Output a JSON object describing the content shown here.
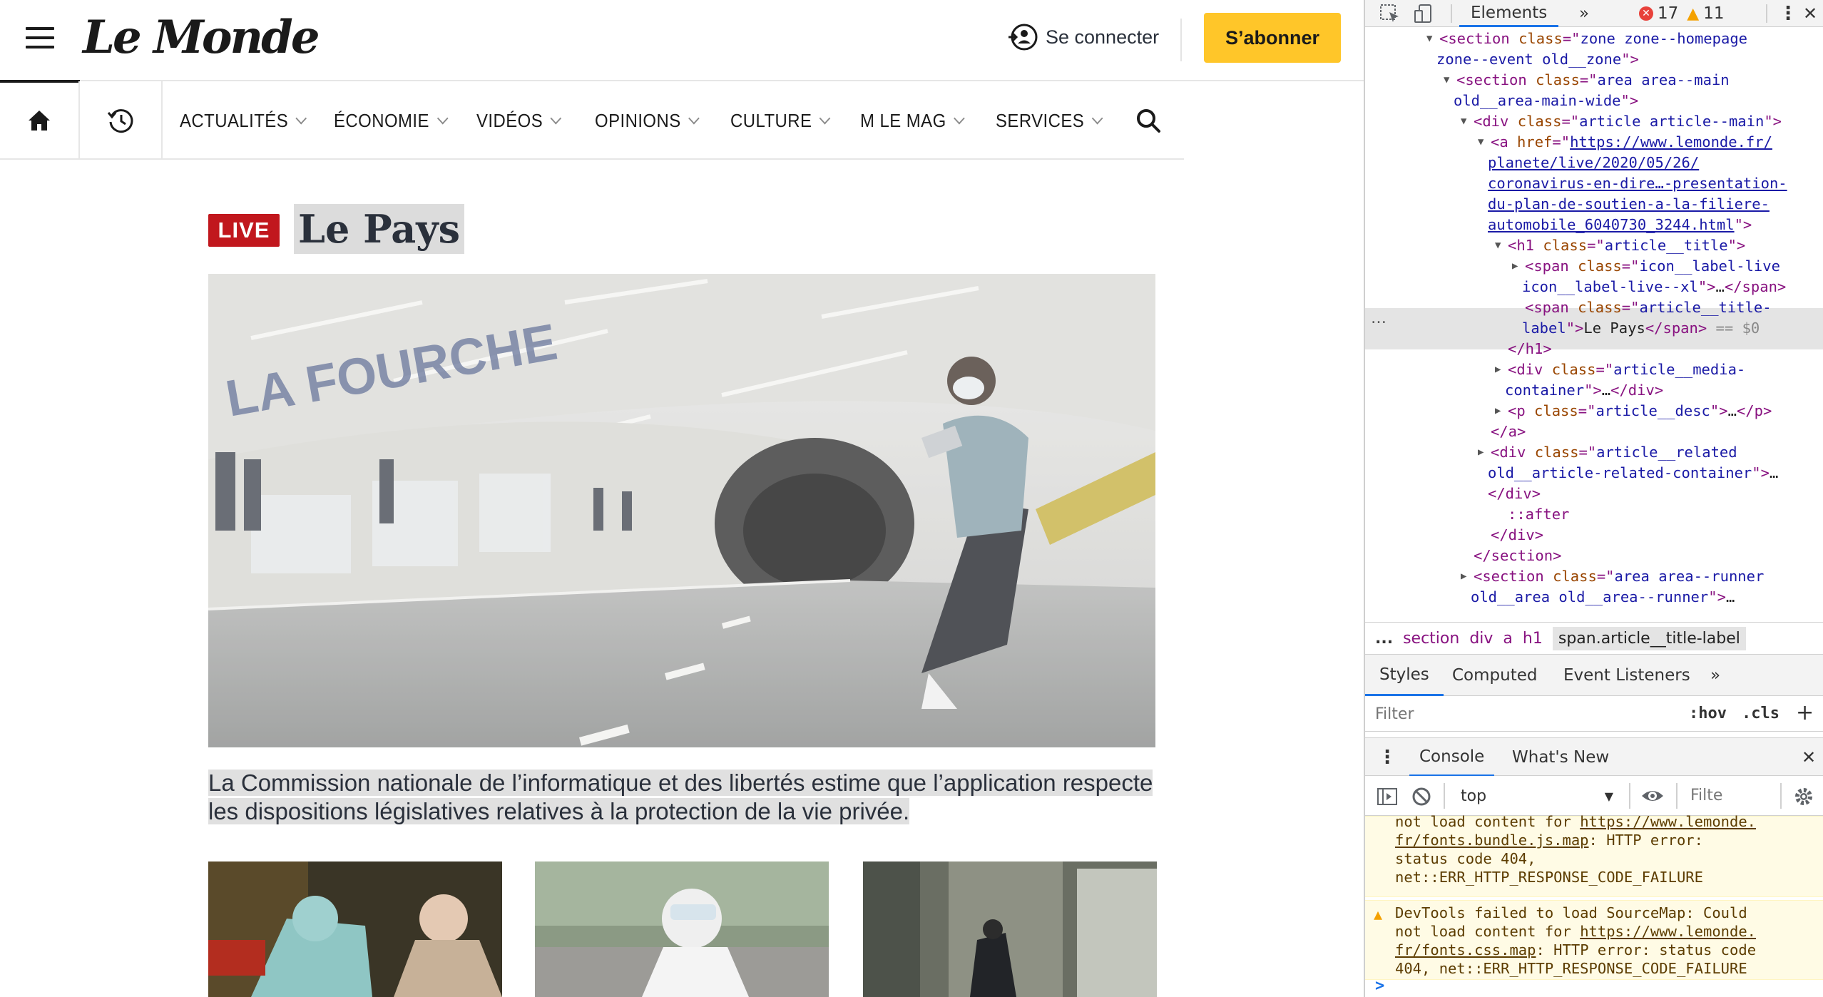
{
  "site": {
    "logo": "Le Monde",
    "connect_label": "Se connecter",
    "subscribe_label": "S’abonner",
    "nav": [
      "ACTUALITÉS",
      "ÉCONOMIE",
      "VIDÉOS",
      "OPINIONS",
      "CULTURE",
      "M LE MAG",
      "SERVICES"
    ],
    "article": {
      "live_badge": "LIVE",
      "title": "Le Pays",
      "desc_line1": "La Commission nationale de l’informatique et des libertés estime que l’application respecte",
      "desc_line2": "les dispositions législatives relatives à la protection de la vie privée."
    },
    "colors": {
      "subscribe": "#ffc629",
      "live": "#c1171d"
    }
  },
  "devtools": {
    "tab_elements": "Elements",
    "tab_more": "»",
    "errors": "17",
    "warnings": "11",
    "dom": [
      {
        "indent": 0,
        "arrow": "▼",
        "parts": [
          [
            "tg",
            "<section "
          ],
          [
            "at",
            "class"
          ],
          [
            "tg",
            "=\""
          ],
          [
            "av",
            "zone zone--homepage"
          ]
        ]
      },
      {
        "indent": 0,
        "cont": true,
        "parts": [
          [
            "av",
            "zone--event old__zone"
          ],
          [
            "tg",
            "\">"
          ]
        ]
      },
      {
        "indent": 1,
        "arrow": "▼",
        "parts": [
          [
            "tg",
            "<section "
          ],
          [
            "at",
            "class"
          ],
          [
            "tg",
            "=\""
          ],
          [
            "av",
            "area area--main"
          ]
        ]
      },
      {
        "indent": 1,
        "cont": true,
        "parts": [
          [
            "av",
            "old__area-main-wide"
          ],
          [
            "tg",
            "\">"
          ]
        ]
      },
      {
        "indent": 2,
        "arrow": "▼",
        "parts": [
          [
            "tg",
            "<div "
          ],
          [
            "at",
            "class"
          ],
          [
            "tg",
            "=\""
          ],
          [
            "av",
            "article article--main"
          ],
          [
            "tg",
            "\">"
          ]
        ]
      },
      {
        "indent": 3,
        "arrow": "▼",
        "parts": [
          [
            "tg",
            "<a "
          ],
          [
            "at",
            "href"
          ],
          [
            "tg",
            "=\""
          ],
          [
            "lk",
            "https://www.lemonde.fr/"
          ]
        ]
      },
      {
        "indent": 3,
        "cont": true,
        "parts": [
          [
            "lk",
            "planete/live/2020/05/26/"
          ]
        ]
      },
      {
        "indent": 3,
        "cont": true,
        "parts": [
          [
            "lk",
            "coronavirus-en-dire…-presentation-"
          ]
        ]
      },
      {
        "indent": 3,
        "cont": true,
        "parts": [
          [
            "lk",
            "du-plan-de-soutien-a-la-filiere-"
          ]
        ]
      },
      {
        "indent": 3,
        "cont": true,
        "parts": [
          [
            "lk",
            "automobile_6040730_3244.html"
          ],
          [
            "tg",
            "\">"
          ]
        ]
      },
      {
        "indent": 4,
        "arrow": "▼",
        "parts": [
          [
            "tg",
            "<h1 "
          ],
          [
            "at",
            "class"
          ],
          [
            "tg",
            "=\""
          ],
          [
            "av",
            "article__title"
          ],
          [
            "tg",
            "\">"
          ]
        ]
      },
      {
        "indent": 5,
        "arrow": "▶",
        "parts": [
          [
            "tg",
            "<span "
          ],
          [
            "at",
            "class"
          ],
          [
            "tg",
            "=\""
          ],
          [
            "av",
            "icon__label-live"
          ]
        ]
      },
      {
        "indent": 5,
        "cont": true,
        "parts": [
          [
            "av",
            "icon__label-live--xl"
          ],
          [
            "tg",
            "\">"
          ],
          [
            "tx",
            "…"
          ],
          [
            "tg",
            "</span>"
          ]
        ]
      },
      {
        "indent": 5,
        "sel": true,
        "parts": [
          [
            "tg",
            "<span "
          ],
          [
            "at",
            "class"
          ],
          [
            "tg",
            "=\""
          ],
          [
            "av",
            "article__title-"
          ]
        ]
      },
      {
        "indent": 5,
        "cont": true,
        "sel": true,
        "parts": [
          [
            "av",
            "label"
          ],
          [
            "tg",
            "\">"
          ],
          [
            "tx",
            "Le Pays"
          ],
          [
            "tg",
            "</span>"
          ],
          [
            "cm",
            " == $0"
          ]
        ]
      },
      {
        "indent": 4,
        "parts": [
          [
            "tg",
            "</h1>"
          ]
        ]
      },
      {
        "indent": 4,
        "arrow": "▶",
        "parts": [
          [
            "tg",
            "<div "
          ],
          [
            "at",
            "class"
          ],
          [
            "tg",
            "=\""
          ],
          [
            "av",
            "article__media-"
          ]
        ]
      },
      {
        "indent": 4,
        "cont": true,
        "parts": [
          [
            "av",
            "container"
          ],
          [
            "tg",
            "\">"
          ],
          [
            "tx",
            "…"
          ],
          [
            "tg",
            "</div>"
          ]
        ]
      },
      {
        "indent": 4,
        "arrow": "▶",
        "parts": [
          [
            "tg",
            "<p "
          ],
          [
            "at",
            "class"
          ],
          [
            "tg",
            "=\""
          ],
          [
            "av",
            "article__desc"
          ],
          [
            "tg",
            "\">"
          ],
          [
            "tx",
            "…"
          ],
          [
            "tg",
            "</p>"
          ]
        ]
      },
      {
        "indent": 3,
        "parts": [
          [
            "tg",
            "</a>"
          ]
        ]
      },
      {
        "indent": 3,
        "arrow": "▶",
        "parts": [
          [
            "tg",
            "<div "
          ],
          [
            "at",
            "class"
          ],
          [
            "tg",
            "=\""
          ],
          [
            "av",
            "article__related"
          ]
        ]
      },
      {
        "indent": 3,
        "cont": true,
        "parts": [
          [
            "av",
            "old__article-related-container"
          ],
          [
            "tg",
            "\">"
          ],
          [
            "tx",
            "…"
          ]
        ]
      },
      {
        "indent": 3,
        "cont": true,
        "parts": [
          [
            "tg",
            "</div>"
          ]
        ]
      },
      {
        "indent": 4,
        "parts": [
          [
            "tg",
            "::after"
          ]
        ]
      },
      {
        "indent": 3,
        "parts": [
          [
            "tg",
            "</div>"
          ]
        ]
      },
      {
        "indent": 2,
        "parts": [
          [
            "tg",
            "</section>"
          ]
        ]
      },
      {
        "indent": 2,
        "arrow": "▶",
        "parts": [
          [
            "tg",
            "<section "
          ],
          [
            "at",
            "class"
          ],
          [
            "tg",
            "=\""
          ],
          [
            "av",
            "area area--runner"
          ]
        ]
      },
      {
        "indent": 2,
        "cont": true,
        "parts": [
          [
            "av",
            "old__area old__area--runner"
          ],
          [
            "tg",
            "\">"
          ],
          [
            "tx",
            "…"
          ]
        ]
      }
    ],
    "breadcrumbs": [
      "...",
      "section",
      "div",
      "a",
      "h1",
      "span.article__title-label"
    ],
    "style_tabs": [
      "Styles",
      "Computed",
      "Event Listeners",
      "»"
    ],
    "filter_placeholder": "Filter",
    "hov": ":hov",
    "cls": ".cls",
    "plus": "+",
    "drawer_tabs": [
      "Console",
      "What's New"
    ],
    "context": "top",
    "console_filter": "Filte",
    "console_msg1": {
      "l1": "not load content for ",
      "l1_link": "https://www.lemonde.",
      "l2_link": "fr/fonts.bundle.js.map",
      "l2": ": HTTP error:",
      "l3": "status code 404,",
      "l4": "net::ERR_HTTP_RESPONSE_CODE_FAILURE"
    },
    "console_msg2": {
      "l1": "DevTools failed to load SourceMap: Could",
      "l2": "not load content for ",
      "l2_link": "https://www.lemonde.",
      "l3_link": "fr/fonts.css.map",
      "l3": ": HTTP error: status code",
      "l4": "404, net::ERR_HTTP_RESPONSE_CODE_FAILURE"
    },
    "prompt": ">"
  }
}
